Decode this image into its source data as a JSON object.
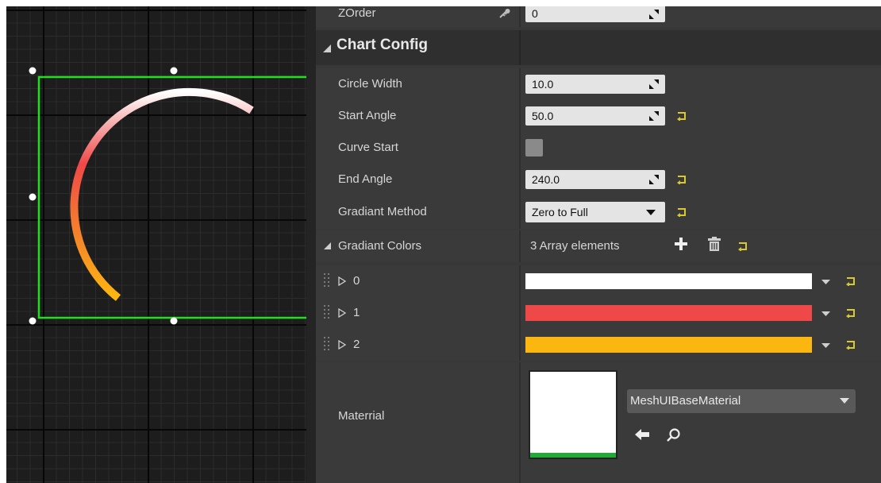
{
  "details": {
    "zorder": {
      "label": "ZOrder",
      "value": "0"
    },
    "section": {
      "title": "Chart Config"
    },
    "circle_width": {
      "label": "Circle Width",
      "value": "10.0"
    },
    "start_angle": {
      "label": "Start Angle",
      "value": "50.0"
    },
    "curve_start": {
      "label": "Curve Start",
      "checked": false
    },
    "end_angle": {
      "label": "End Angle",
      "value": "240.0"
    },
    "gradiant_method": {
      "label": "Gradiant Method",
      "value": "Zero to Full"
    },
    "gradiant_colors": {
      "label": "Gradiant Colors",
      "count_text": "3 Array elements",
      "items": [
        {
          "index": "0",
          "color": "#ffffff"
        },
        {
          "index": "1",
          "color": "#ef4848"
        },
        {
          "index": "2",
          "color": "#fbb710"
        }
      ]
    },
    "material": {
      "label": "Materrial",
      "value": "MeshUIBaseMaterial"
    }
  },
  "colors": {
    "selection_outline": "#22dd22",
    "arc_gradient": [
      "#ffffff",
      "#ef4848",
      "#fbb710"
    ],
    "reset_arrow": "#d7c92f",
    "material_bar": "#23a83a"
  },
  "icons": [
    "spin-arrows-icon",
    "reset-arrow-icon",
    "plus-icon",
    "trash-icon",
    "dropdown-arrow-icon",
    "browse-arrow-icon",
    "search-icon",
    "expand-triangle-icon",
    "drag-handle-icon",
    "key-icon"
  ]
}
